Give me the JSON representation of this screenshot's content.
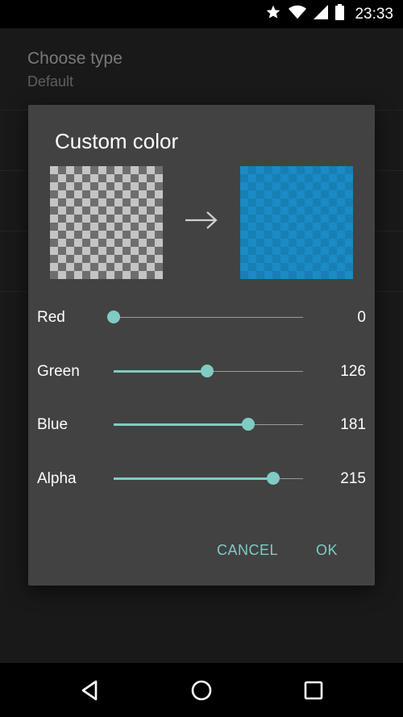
{
  "status_bar": {
    "time": "23:33",
    "icons": [
      "star-icon",
      "wifi-icon",
      "signal-icon",
      "battery-icon"
    ]
  },
  "background": {
    "setting_title": "Choose type",
    "setting_value": "Default"
  },
  "dialog": {
    "title": "Custom color",
    "source_swatch": "transparent-checkerboard",
    "result_color": "#007EB5",
    "arrow_icon": "arrow-right-icon",
    "sliders": [
      {
        "label": "Red",
        "value": "0",
        "fraction": 0.0
      },
      {
        "label": "Green",
        "value": "126",
        "fraction": 0.494
      },
      {
        "label": "Blue",
        "value": "181",
        "fraction": 0.71
      },
      {
        "label": "Alpha",
        "value": "215",
        "fraction": 0.843
      }
    ],
    "cancel_label": "CANCEL",
    "ok_label": "OK"
  },
  "nav_bar": {
    "icons": [
      "back-icon",
      "home-icon",
      "recents-icon"
    ]
  },
  "colors": {
    "accent": "#80CBC4",
    "dialog_bg": "#424242",
    "screen_bg": "#191919"
  }
}
